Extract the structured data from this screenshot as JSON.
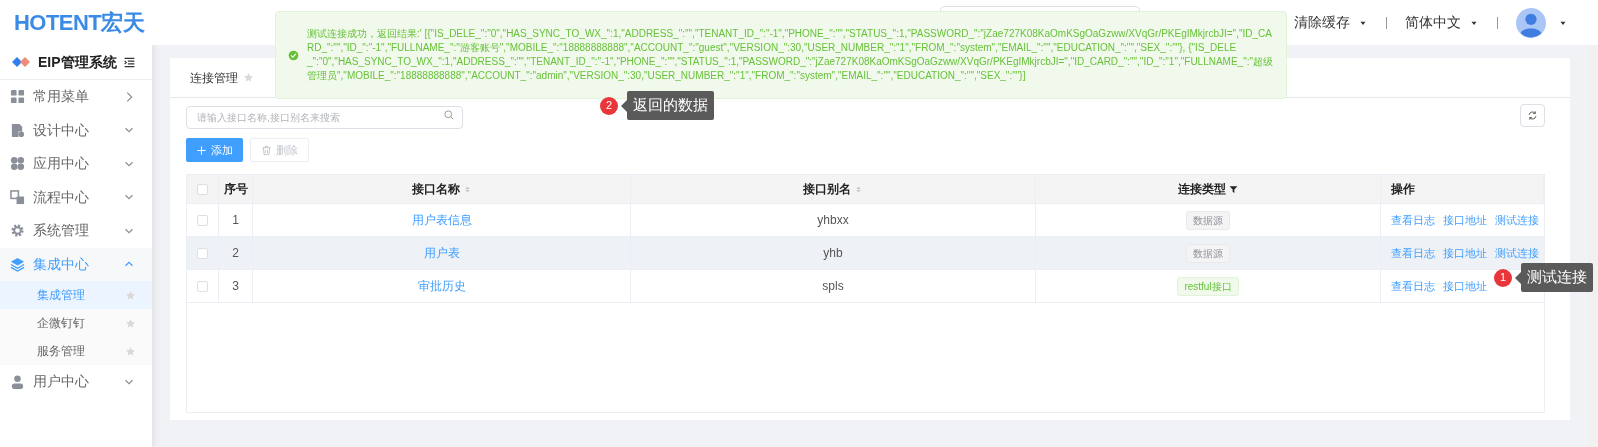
{
  "header": {
    "logo": "HOTENT宏天",
    "cache_menu": "清除缓存",
    "language": "简体中文"
  },
  "sidebar": {
    "title": "EIP管理系统",
    "items": [
      {
        "label": "常用菜单",
        "expanded": false,
        "selected": false
      },
      {
        "label": "设计中心",
        "expanded": false,
        "selected": false
      },
      {
        "label": "应用中心",
        "expanded": false,
        "selected": false
      },
      {
        "label": "流程中心",
        "expanded": false,
        "selected": false
      },
      {
        "label": "系统管理",
        "expanded": false,
        "selected": false
      },
      {
        "label": "集成中心",
        "expanded": true,
        "selected": true,
        "children": [
          {
            "label": "集成管理",
            "selected": true
          },
          {
            "label": "企微钉钉",
            "selected": false
          },
          {
            "label": "服务管理",
            "selected": false
          }
        ]
      },
      {
        "label": "用户中心",
        "expanded": false,
        "selected": false
      }
    ]
  },
  "tab": {
    "label": "连接管理"
  },
  "search": {
    "placeholder": "请输入接口名称,接口别名来搜索"
  },
  "buttons": [
    {
      "label": "添加",
      "disabled": false
    },
    {
      "label": "删除",
      "disabled": true
    }
  ],
  "table": {
    "all_checked": false,
    "columns": [
      {
        "label": "序号",
        "kind": "plain"
      },
      {
        "label": "接口名称",
        "kind": "sort"
      },
      {
        "label": "接口别名",
        "kind": "sort"
      },
      {
        "label": "连接类型",
        "kind": "filter"
      },
      {
        "label": "操作",
        "kind": "plain"
      }
    ],
    "rows": [
      {
        "index": "1",
        "name": "用户表信息",
        "alias": "yhbxx",
        "type": {
          "label": "数据源",
          "kind": "datasource"
        },
        "actions": [
          "查看日志",
          "接口地址",
          "测试连接"
        ],
        "checked": false,
        "highlighted": false
      },
      {
        "index": "2",
        "name": "用户表",
        "alias": "yhb",
        "type": {
          "label": "数据源",
          "kind": "datasource"
        },
        "actions": [
          "查看日志",
          "接口地址",
          "测试连接"
        ],
        "checked": false,
        "highlighted": true
      },
      {
        "index": "3",
        "name": "审批历史",
        "alias": "spls",
        "type": {
          "label": "restful接口",
          "kind": "restful"
        },
        "actions": [
          "查看日志",
          "接口地址"
        ],
        "checked": false,
        "highlighted": false
      }
    ]
  },
  "toast": {
    "message": "测试连接成功，返回结果:' [{\"IS_DELE_\":\"0\",\"HAS_SYNC_TO_WX_\":1,\"ADDRESS_\":\"\",\"TENANT_ID_\":\"-1\",\"PHONE_\":\"\",\"STATUS_\":1,\"PASSWORD_\":\"jZae727K08KaOmKSgOaGzww/XVqGr/PKEgIMkjrcbJI=\",\"ID_CARD_\":\"\",\"ID_\":\"-1\",\"FULLNAME_\":\"游客账号\",\"MOBILE_\":\"18888888888\",\"ACCOUNT_\":\"guest\",\"VERSION_\":30,\"USER_NUMBER_\":\"1\",\"FROM_\":\"system\",\"EMAIL_\":\"\",\"EDUCATION_\":\"\",\"SEX_\":\"\"}, {\"IS_DELE_\":\"0\",\"HAS_SYNC_TO_WX_\":1,\"ADDRESS_\":\"\",\"TENANT_ID_\":\"-1\",\"PHONE_\":\"\",\"STATUS_\":1,\"PASSWORD_\":\"jZae727K08KaOmKSgOaGzww/XVqGr/PKEgIMkjrcbJI=\",\"ID_CARD_\":\"\",\"ID_\":\"1\",\"FULLNAME_\":\"超级管理员\",\"MOBILE_\":\"18888888888\",\"ACCOUNT_\":\"admin\",\"VERSION_\":30,\"USER_NUMBER_\":\"1\",\"FROM_\":\"system\",\"EMAIL_\":\"\",\"EDUCATION_\":\"\",\"SEX_\":\"\"}]"
  },
  "callouts": [
    {
      "number": "2",
      "text": "返回的数据"
    },
    {
      "number": "1",
      "text": "测试连接"
    }
  ]
}
